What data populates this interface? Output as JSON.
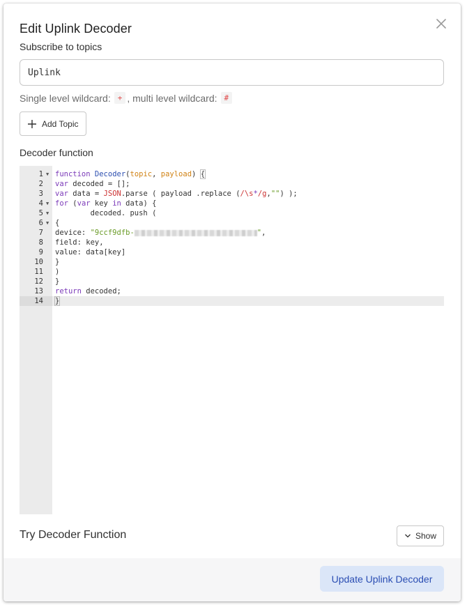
{
  "dialog": {
    "title": "Edit Uplink Decoder",
    "subscribe_label": "Subscribe to topics",
    "topic_value": "Uplink",
    "wildcard_text_1": "Single level wildcard:",
    "wildcard_single": "+",
    "wildcard_text_2": ", multi level wildcard:",
    "wildcard_multi": "#",
    "add_topic_label": "Add Topic",
    "decoder_label": "Decoder function",
    "try_label": "Try Decoder Function",
    "show_label": "Show",
    "update_label": "Update Uplink Decoder"
  },
  "editor": {
    "active_line": 14,
    "line_numbers": [
      "1",
      "2",
      "3",
      "4",
      "5",
      "6",
      "7",
      "8",
      "9",
      "10",
      "11",
      "12",
      "13",
      "14"
    ],
    "code": {
      "l1_kw": "function",
      "l1_name": "Decoder",
      "l1_open": "(",
      "l1_p1": "topic",
      "l1_sep": ", ",
      "l1_p2": "payload",
      "l1_close": ") ",
      "l1_brace": "{",
      "l2_kw": "var",
      "l2_rest": " decoded = [];",
      "l3_kw": "var",
      "l3_a": " data = ",
      "l3_json": "JSON",
      "l3_b": ".parse ( payload .replace (",
      "l3_re1": "/\\s",
      "l3_re2": "*",
      "l3_re3": "/g",
      "l3_c": ",",
      "l3_str": "\"\"",
      "l3_d": ") );",
      "l4_kw": "for",
      "l4_a": " (",
      "l4_var": "var",
      "l4_b": " key ",
      "l4_in": "in",
      "l4_c": " data) {",
      "l5": "        decoded. push (",
      "l6": "{",
      "l7_a": "device: ",
      "l7_str": "\"9ccf9dfb-",
      "l7_end": "\"",
      "l7_comma": ",",
      "l8": "field: key,",
      "l9": "value: data[key]",
      "l10": "}",
      "l11": ")",
      "l12": "}",
      "l13_kw": "return",
      "l13_rest": " decoded;",
      "l14": "}"
    }
  },
  "icons": {
    "close": "close-icon",
    "add": "plus-icon",
    "show": "chevron-down-icon"
  },
  "colors": {
    "accent": "#2b4eb3",
    "primary_button_bg": "#dbe6f8",
    "chip_text": "#e04848"
  }
}
